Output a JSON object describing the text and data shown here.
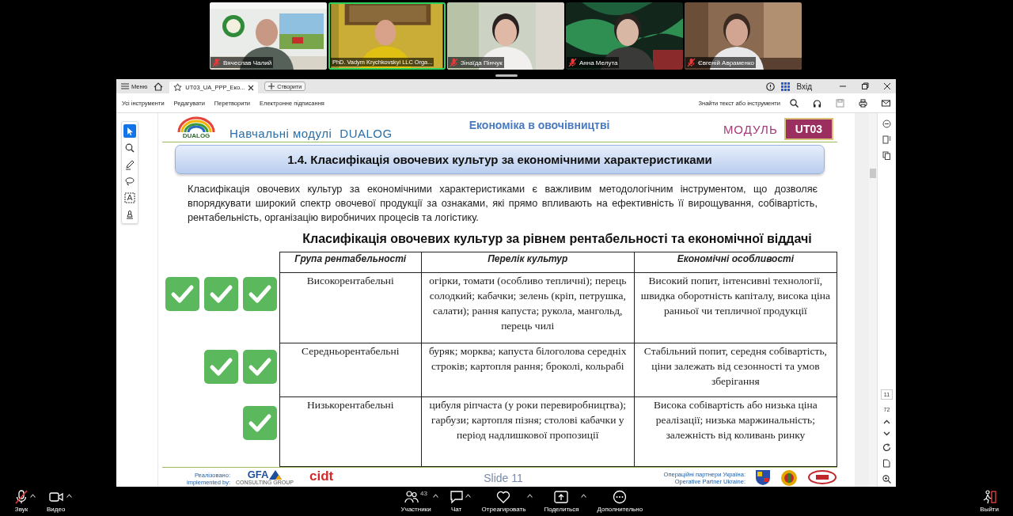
{
  "video_tiles": [
    {
      "name": "Вячеслав Чалий",
      "muted": true,
      "speaking": false
    },
    {
      "name": "PhD. Vadym Krychkovskyi LLC Orga...",
      "muted": false,
      "speaking": true
    },
    {
      "name": "Зінаїда Пінчук",
      "muted": true,
      "speaking": false
    },
    {
      "name": "Анна Мелута",
      "muted": true,
      "speaking": false
    },
    {
      "name": "Євгеній Авраменко",
      "muted": true,
      "speaking": false
    }
  ],
  "pdf_viewer": {
    "tab_bar": {
      "menu": "Меню",
      "tab_title": "UT03_UA_PPP_Еко...",
      "new_button": "Створити",
      "sign_in": "Вхід"
    },
    "toolbar": {
      "items": [
        "Усі інструменти",
        "Редагувати",
        "Перетворити",
        "Електронне підписання"
      ],
      "search": "Знайти текст або інструменти"
    },
    "left_tools": [
      {
        "kind": "select",
        "selected": true
      },
      {
        "kind": "zoom",
        "selected": false
      },
      {
        "kind": "pen",
        "selected": false
      },
      {
        "kind": "lasso",
        "selected": false
      },
      {
        "kind": "text",
        "selected": false
      },
      {
        "kind": "stamp",
        "selected": false
      }
    ],
    "page_nav": {
      "current_page": "11",
      "total_pages": "72"
    },
    "slide": {
      "header": {
        "logo_text": "DUALOG",
        "series": "Навчальні модулі",
        "series_brand": "DUALOG",
        "topic": "Економіка в овочівництві",
        "module_label": "МОДУЛЬ",
        "module_code": "UT03"
      },
      "section_title": "1.4. Класифікація овочевих культур за економічними характеристиками",
      "intro": "Класифікація овочевих культур за економічними характеристиками є важливим методологічним інструментом, що дозволяє впорядкувати широкий спектр овочевої продукції за ознаками, які прямо впливають на ефективність її вирощування, собівартість, рентабельність, організацію виробничих процесів та логістику.",
      "table_title": "Класифікація овочевих культур за рівнем рентабельності та економічної віддачі",
      "table": {
        "columns": [
          "Група рентабельності",
          "Перелік культур",
          "Економічні особливості"
        ],
        "rows": [
          {
            "check_marks": [
              {
                "checked": true
              },
              {
                "checked": true
              },
              {
                "checked": true
              }
            ],
            "cells": [
              "Високорентабельні",
              "огірки, томати (особливо тепличні); перець солодкий; кабачки; зелень (кріп, петрушка, салати); рання капуста; рукола, мангольд, перець чилі",
              "Високий попит, інтенсивні технології, швидка оборотність капіталу, висока ціна ранньої чи тепличної продукції"
            ]
          },
          {
            "check_marks": [
              {
                "checked": true
              },
              {
                "checked": true
              }
            ],
            "cells": [
              "Середньорентабельні",
              "буряк; морква; капуста білоголова середніх строків; картопля рання; броколі, кольрабі",
              "Стабільний попит, середня собівартість, ціни залежать від сезонності та умов зберігання"
            ]
          },
          {
            "check_marks": [
              {
                "checked": true
              }
            ],
            "cells": [
              "Низькорентабельні",
              "цибуля ріпчаста (у роки перевиробництва); гарбузи; картопля пізня; столові кабачки у період надлишкової пропозиції",
              "Висока собівартість або низька ціна реалізації; низька маржинальність; залежність від коливань ринку"
            ]
          }
        ]
      },
      "footer": {
        "implemented_label": "Реалізовано:",
        "implemented_label_en": "implemented by:",
        "logo_gfa": "GFA",
        "logo_gfa_sub": "CONSULTING GROUP",
        "logo_cidt": "cidt",
        "slide_label": "Slide 11",
        "partners_label": "Операційні партнери Україна:",
        "partners_label_en": "Operative Partner Ukraine:"
      }
    }
  },
  "call_controls": [
    {
      "kind": "mic",
      "label": "Звук",
      "muted": true
    },
    {
      "kind": "video",
      "label": "Видео",
      "muted": false
    },
    {
      "kind": "participants",
      "label": "Участники",
      "count": "43"
    },
    {
      "kind": "chat",
      "label": "Чат"
    },
    {
      "kind": "react",
      "label": "Отреагировать"
    },
    {
      "kind": "share",
      "label": "Поделиться"
    },
    {
      "kind": "more",
      "label": "Дополнительно"
    },
    {
      "kind": "leave",
      "label": "Выйти"
    }
  ]
}
